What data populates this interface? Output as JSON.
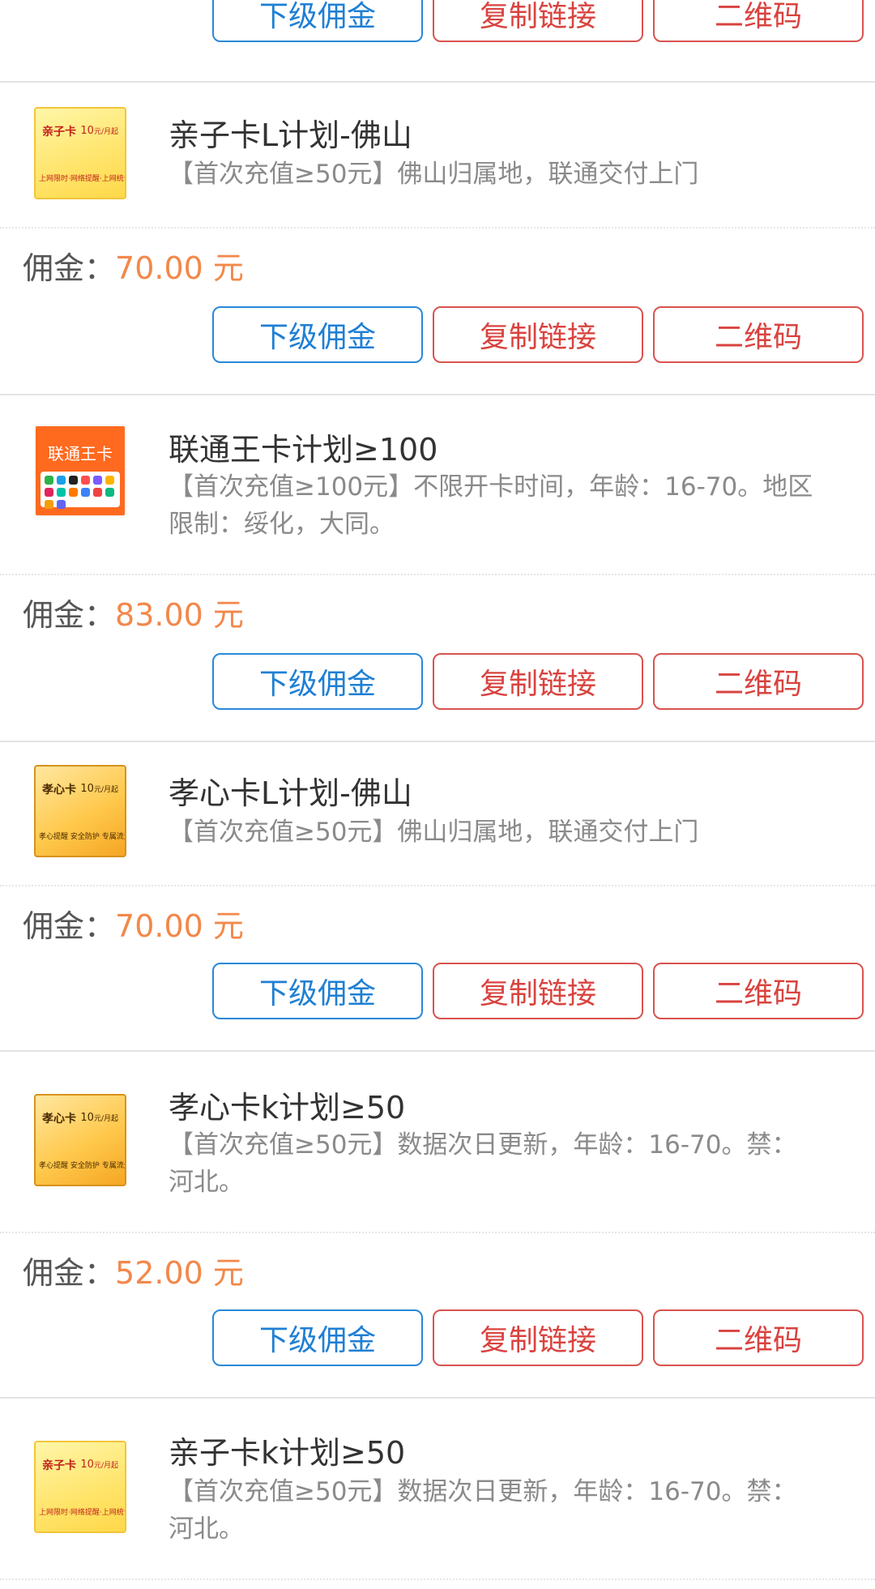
{
  "buttons": {
    "sub_commission": "下级佣金",
    "copy_link": "复制链接",
    "qr_code": "二维码"
  },
  "commission_label": "佣金：",
  "unit": "元",
  "products": [
    {
      "name": "亲子卡L计划-佛山",
      "desc": "【首次充值≥50元】佛山归属地，联通交付上门",
      "amount": "70.00",
      "thumb": {
        "title": "亲子卡",
        "price": "10",
        "price_unit": "元/月起",
        "tagline": "上网限时·网络提醒·上网统计"
      }
    },
    {
      "name": "联通王卡计划≥100",
      "desc": "【首次充值≥100元】不限开卡时间，年龄：16-70。地区限制：绥化，大同。",
      "amount": "83.00",
      "thumb": {
        "title": "联通王卡"
      }
    },
    {
      "name": "孝心卡L计划-佛山",
      "desc": "【首次充值≥50元】佛山归属地，联通交付上门",
      "amount": "70.00",
      "thumb": {
        "title": "孝心卡",
        "price": "10",
        "price_unit": "元/月起",
        "tagline": "孝心提醒 安全防护 专属流量"
      }
    },
    {
      "name": "孝心卡k计划≥50",
      "desc": "【首次充值≥50元】数据次日更新，年龄：16-70。禁：河北。",
      "amount": "52.00",
      "thumb": {
        "title": "孝心卡",
        "price": "10",
        "price_unit": "元/月起",
        "tagline": "孝心提醒 安全防护 专属流量"
      }
    },
    {
      "name": "亲子卡k计划≥50",
      "desc": "【首次充值≥50元】数据次日更新，年龄：16-70。禁：河北。",
      "thumb": {
        "title": "亲子卡",
        "price": "10",
        "price_unit": "元/月起",
        "tagline": "上网限时·网络提醒·上网统计"
      }
    }
  ],
  "colors": {
    "blue_button": "#1f7fd4",
    "red_button": "#d9433f",
    "amount": "#f2884a"
  }
}
